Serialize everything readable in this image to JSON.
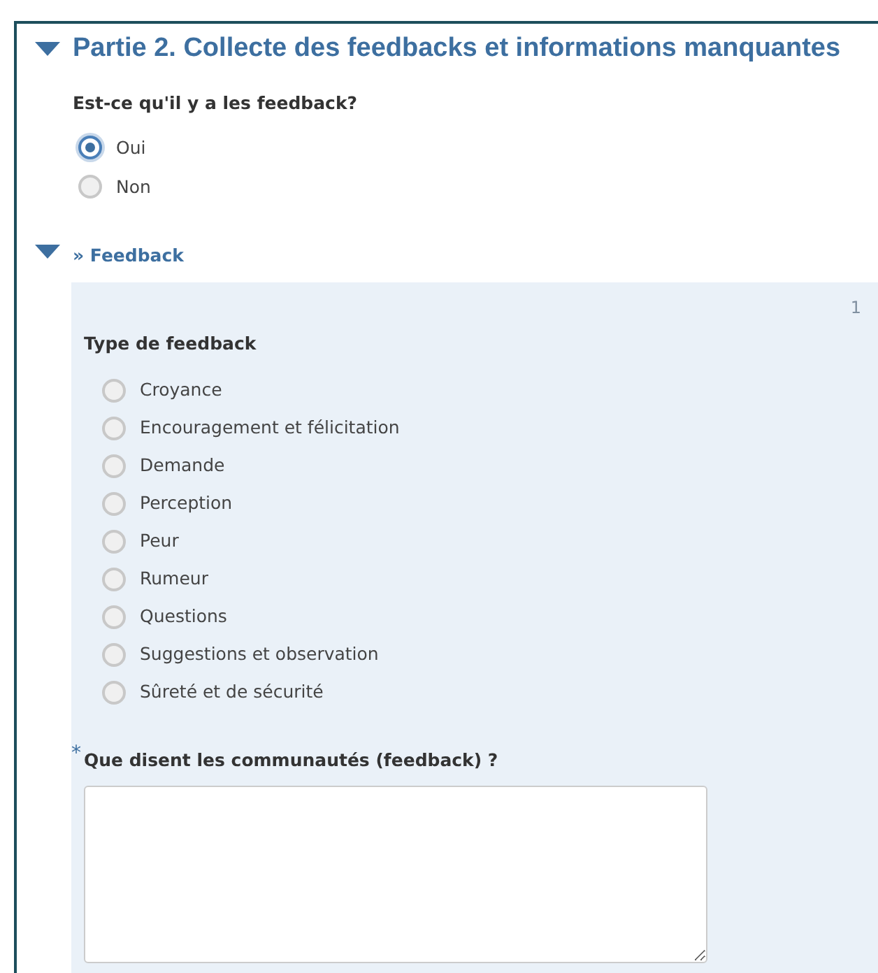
{
  "section": {
    "title": "Partie 2. Collecte des feedbacks et informations manquantes",
    "expanded": true
  },
  "question": {
    "label": "Est-ce qu'il y a les feedback?",
    "options": [
      {
        "label": "Oui",
        "selected": true
      },
      {
        "label": "Non",
        "selected": false
      }
    ]
  },
  "group": {
    "title": "» Feedback",
    "expanded": true,
    "repeat_index": "1",
    "type_question": {
      "label": "Type de feedback",
      "options": [
        {
          "label": "Croyance",
          "selected": false
        },
        {
          "label": "Encouragement et félicitation",
          "selected": false
        },
        {
          "label": "Demande",
          "selected": false
        },
        {
          "label": "Perception",
          "selected": false
        },
        {
          "label": "Peur",
          "selected": false
        },
        {
          "label": "Rumeur",
          "selected": false
        },
        {
          "label": "Questions",
          "selected": false
        },
        {
          "label": "Suggestions et observation",
          "selected": false
        },
        {
          "label": "Sûreté et de sécurité",
          "selected": false
        }
      ]
    },
    "text_question": {
      "required_mark": "*",
      "label": "Que disent les communautés (feedback) ?"
    }
  }
}
